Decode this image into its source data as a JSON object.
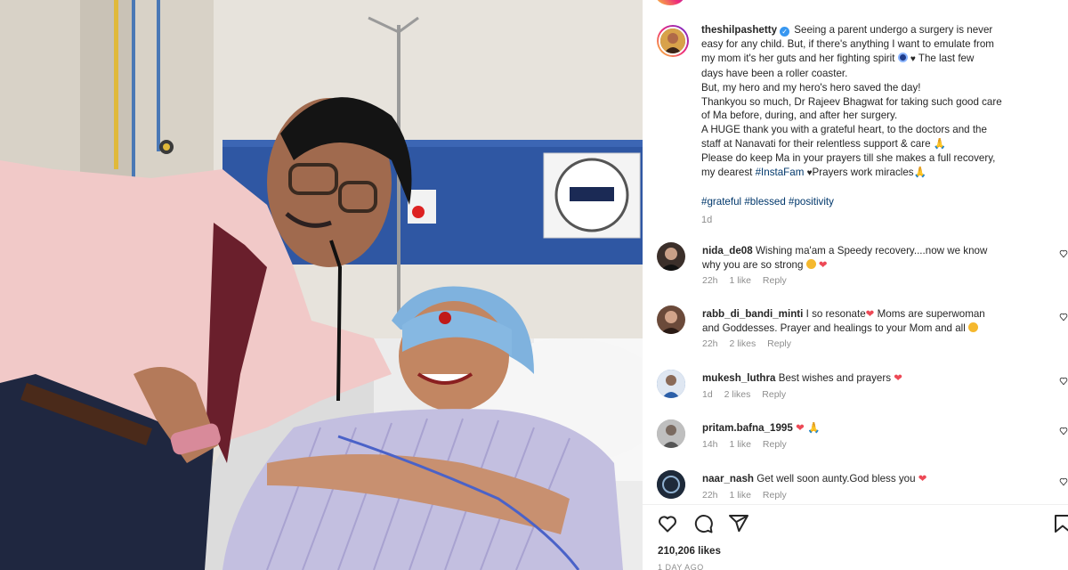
{
  "post": {
    "username": "theshilpashetty",
    "caption_lines": [
      "Seeing a parent undergo a surgery is never",
      "easy for any child. But, if there's anything I want to emulate from",
      "my mom it's her guts and her fighting spirit",
      "The last few",
      "days have been a roller coaster.",
      "But, my hero and my hero's hero saved the day!",
      "Thankyou so much, Dr Rajeev Bhagwat for taking such good care",
      "of Ma before, during, and after her surgery.",
      "A HUGE thank you with a grateful heart, to the doctors and the",
      "staff at Nanavati for their relentless support & care",
      "Please do keep Ma in your prayers till she makes a full recovery,",
      "my dearest",
      "#InstaFam",
      "Prayers work miracles"
    ],
    "hashtags": [
      "#grateful",
      "#blessed",
      "#positivity"
    ],
    "time": "1d"
  },
  "comments": [
    {
      "user": "nida_de08",
      "text": "Wishing ma'am a Speedy recovery....now we know",
      "text2": "why you are so strong",
      "time": "22h",
      "likes": "1 like",
      "reply": "Reply",
      "avatar_color": "#3b2f2a"
    },
    {
      "user": "rabb_di_bandi_minti",
      "text": "I so resonate",
      "text_b": "Moms are superwoman",
      "text2": "and Goddesses. Prayer and healings to your Mom and all",
      "time": "22h",
      "likes": "2 likes",
      "reply": "Reply",
      "avatar_color": "#6b4a3a"
    },
    {
      "user": "mukesh_luthra",
      "text": "Best wishes and prayers",
      "time": "1d",
      "likes": "2 likes",
      "reply": "Reply",
      "avatar_color": "#2c5fa8"
    },
    {
      "user": "pritam.bafna_1995",
      "text": "",
      "time": "14h",
      "likes": "1 like",
      "reply": "Reply",
      "avatar_color": "#9a9a9a"
    },
    {
      "user": "naar_nash",
      "text": "Get well soon aunty.God bless you",
      "time": "22h",
      "likes": "1 like",
      "reply": "Reply",
      "avatar_color": "#1e2a3a"
    }
  ],
  "likes": "210,206 likes",
  "days_ago": "1 DAY AGO",
  "colors": {
    "heart": "#ed4956",
    "link": "#00376b",
    "muted": "#8e8e8e",
    "verified": "#3897f0"
  }
}
